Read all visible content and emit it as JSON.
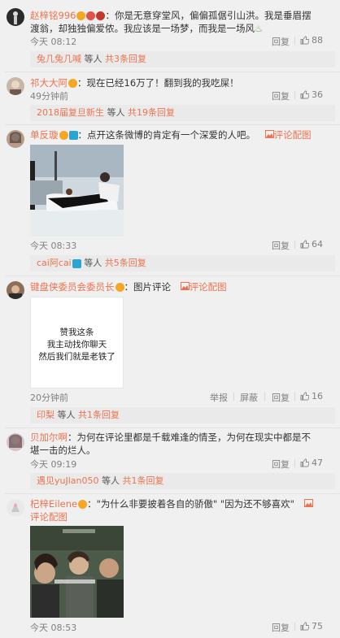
{
  "comments": [
    {
      "user": "赵梓铭996",
      "text_line1": "：你是无意穿堂风，偏偏孤倨引山洪。我是垂眉摆",
      "text_line2": "渡翁，却独独偏爱侬。我应该是一场梦，而我是一场风",
      "time": "今天 08:12",
      "reply": "回复",
      "likes": "88",
      "sub": {
        "user": "兔几兔几喊",
        "mid": "等人",
        "count": "共3条回复"
      }
    },
    {
      "user": "祁大大阿",
      "text_line1": "：现在已经16万了！翻到我的我吃屎！",
      "time": "49分钟前",
      "reply": "回复",
      "likes": "36",
      "sub": {
        "user": "2018届复旦新生",
        "mid": "等人",
        "count": "共19条回复"
      }
    },
    {
      "user": "单反璇",
      "text_line1": "：点开这条微博的肯定有一个深爱的人吧。",
      "pic_link": "评论配图",
      "time": "今天 08:33",
      "reply": "回复",
      "likes": "64",
      "sub": {
        "user": "cai阿cai",
        "mid": "等人",
        "count": "共5条回复"
      }
    },
    {
      "user": "键盘侠委员会委员长",
      "text_line1": "：图片评论",
      "pic_link": "评论配图",
      "meme_lines": [
        "赞我这条",
        "我主动找你聊天",
        "然后我们就是老铁了"
      ],
      "time": "20分钟前",
      "report": "举报",
      "block": "屏蔽",
      "reply": "回复",
      "likes": "16",
      "sub": {
        "user": "印梨",
        "mid": "等人",
        "count": "共1条回复"
      }
    },
    {
      "user": "贝加尔啊",
      "text_line1": "：为何在评论里都是千载难逢的情圣，为何在现实中都是不",
      "text_line2": "堪一击的烂人。",
      "time": "今天 09:19",
      "reply": "回复",
      "likes": "47",
      "sub": {
        "user": "遇见yuJlan050",
        "mid": "等人",
        "count": "共1条回复"
      }
    },
    {
      "user": "杞梓Eilene",
      "text_line1": "：\"为什么非要披着各自的骄傲\" \"因为还不够喜欢\"",
      "pic_link": "评论配图",
      "time": "今天 08:53",
      "reply": "回复",
      "likes": "75"
    }
  ],
  "icons": {
    "thumb": "thumbs-up-icon",
    "picture": "picture-icon"
  },
  "colors": {
    "accent": "#eb7350",
    "meta": "#808080",
    "reply_bg": "#eaeaea"
  }
}
